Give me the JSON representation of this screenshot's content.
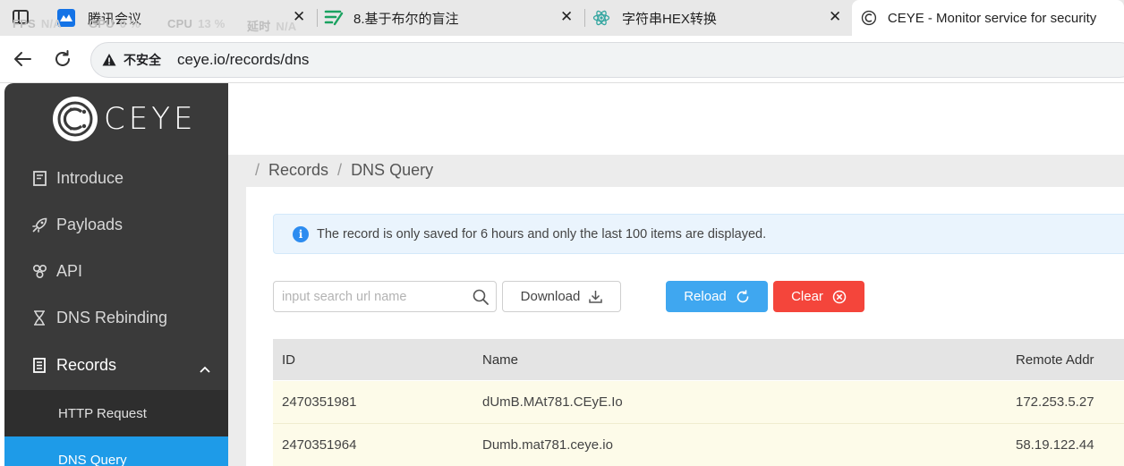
{
  "browser": {
    "tabs": [
      {
        "title": "腾讯会议",
        "icon": "tencent-meeting-icon"
      },
      {
        "title": "8.基于布尔的盲注",
        "icon": "note-icon"
      },
      {
        "title": "字符串HEX转换",
        "icon": "react-icon"
      },
      {
        "title": "CEYE - Monitor service for security",
        "icon": "ceye-icon",
        "active": true
      }
    ],
    "perf_overlay": {
      "fps_label": "FPS",
      "fps_value": "N/A",
      "gpu_label": "GPU",
      "gpu_value": "0 %",
      "cpu_label": "CPU",
      "cpu_value": "13 %",
      "latency_label": "延时",
      "latency_value": "N/A"
    },
    "security_label": "不安全",
    "url": "ceye.io/records/dns"
  },
  "sidebar": {
    "logo_text": "CEYE",
    "items": [
      {
        "label": "Introduce",
        "icon": "document-icon"
      },
      {
        "label": "Payloads",
        "icon": "rocket-icon"
      },
      {
        "label": "API",
        "icon": "api-icon"
      },
      {
        "label": "DNS Rebinding",
        "icon": "hourglass-icon"
      },
      {
        "label": "Records",
        "icon": "list-icon",
        "expanded": true
      }
    ],
    "submenu": [
      {
        "label": "HTTP Request"
      },
      {
        "label": "DNS Query",
        "active": true
      }
    ]
  },
  "breadcrumb": {
    "items": [
      "Records",
      "DNS Query"
    ],
    "separator": "/"
  },
  "alert": {
    "text": "The record is only saved for 6 hours and only the last 100 items are displayed."
  },
  "toolbar": {
    "search_placeholder": "input search url name",
    "download_label": "Download",
    "reload_label": "Reload",
    "clear_label": "Clear"
  },
  "table": {
    "columns": [
      "ID",
      "Name",
      "Remote Addr"
    ],
    "rows": [
      {
        "id": "2470351981",
        "name": "dUmB.MAt781.CEyE.Io",
        "addr": "172.253.5.27"
      },
      {
        "id": "2470351964",
        "name": "Dumb.mat781.ceye.io",
        "addr": "58.19.122.44"
      }
    ]
  },
  "colors": {
    "sidebar_bg": "#3a3a3a",
    "active_blue": "#1e9be8",
    "reload_blue": "#3fa7f0",
    "clear_red": "#f4453b",
    "row_bg": "#fdfbe9"
  }
}
